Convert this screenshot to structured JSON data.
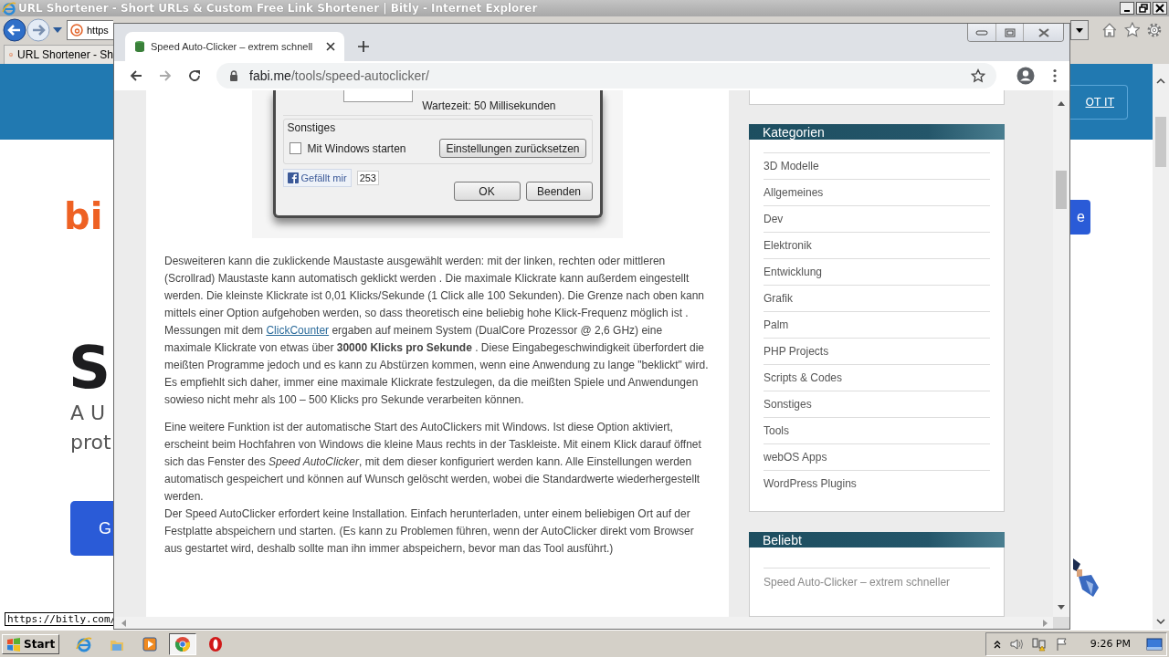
{
  "ie": {
    "title": "URL Shortener - Short URLs & Custom Free Link Shortener | Bitly - Internet Explorer",
    "address": "https",
    "tab": "URL Shortener - Sh",
    "page": {
      "banner_button": "OT IT",
      "logo": "bi",
      "heading": "S",
      "subtitle": [
        "A U",
        "prot"
      ],
      "cta": "G",
      "side_button": "e"
    },
    "status_tip": "https://bitly.com/"
  },
  "chrome": {
    "tab": {
      "title": "Speed Auto-Clicker – extrem schnell",
      "selected": true
    },
    "url": {
      "host": "fabi.me",
      "path": "/tools/speed-autoclicker/"
    },
    "screenshot": {
      "wait_text": "Wartezeit: 50 Millisekunden",
      "group": "Sonstiges",
      "checkbox": {
        "label": "Mit Windows starten",
        "checked": false
      },
      "reset_button": "Einstellungen zurücksetzen",
      "like": "Gefällt mir",
      "like_count": "253",
      "buttons": [
        "OK",
        "Beenden"
      ]
    },
    "article": [
      [
        {
          "segments": [
            {
              "kind": "text",
              "text": "Desweiteren kann die zuklickende Maustaste ausgewählt werden: mit der linken, rechten oder mittleren (Scrollrad) Maustaste kann automatisch geklickt werden . Die maximale Klickrate kann außerdem eingestellt werden. Die kleinste Klickrate ist 0,01 Klicks/Sekunde (1 Click alle 100 Sekunden). Die Grenze nach oben kann mittels einer Option aufgehoben werden, so dass theoretisch eine beliebig hohe Klick-Frequenz möglich ist ."
            }
          ]
        },
        {
          "segments": [
            {
              "kind": "text",
              "text": "Messungen mit dem "
            },
            {
              "kind": "link",
              "text": "ClickCounter"
            },
            {
              "kind": "text",
              "text": " ergaben auf meinem System (DualCore Prozessor @ 2,6 GHz) eine maximale Klickrate von etwas über **30000 Klicks pro Sekunde** . Diese Eingabegeschwindigkeit überfordert die meißten Programme jedoch und es kann zu Abstürzen kommen, wenn eine Anwendung zu lange \"beklickt\" wird. Es empfiehlt sich daher, immer eine maximale Klickrate festzulegen, da die meißten Spiele und Anwendungen sowieso nicht mehr als 100 – 500 Klicks pro Sekunde verarbeiten können."
            }
          ]
        }
      ],
      [
        {
          "segments": [
            {
              "kind": "text",
              "text": "Eine weitere Funktion ist der automatische Start des AutoClickers mit Windows. Ist diese Option aktiviert, erscheint beim Hochfahren von Windows die kleine Maus rechts in der Taskleiste. Mit einem Klick darauf öffnet sich das Fenster des *Speed AutoClicker*,  mit dem dieser konfiguriert werden kann. Alle Einstellungen werden automatisch gespeichert und können auf Wunsch gelöscht werden, wobei die Standardwerte wiederhergestellt werden."
            }
          ]
        },
        {
          "segments": [
            {
              "kind": "text",
              "text": "Der Speed AutoClicker erfordert keine Installation. Einfach herunterladen, unter einem beliebigen Ort auf der Festplatte abspeichern und starten. (Es kann zu Problemen führen, wenn der AutoClicker direkt vom Browser aus gestartet wird, deshalb sollte man ihn immer abspeichern, bevor man das Tool ausführt.)"
            }
          ]
        }
      ]
    ],
    "sidebar": {
      "categories": {
        "title": "Kategorien",
        "items": [
          "3D Modelle",
          "Allgemeines",
          "Dev",
          "Elektronik",
          "Entwicklung",
          "Grafik",
          "Palm",
          "PHP Projects",
          "Scripts & Codes",
          "Sonstiges",
          "Tools",
          "webOS Apps",
          "WordPress Plugins"
        ]
      },
      "popular": {
        "title": "Beliebt",
        "items": [
          "Speed Auto-Clicker – extrem schneller"
        ]
      }
    }
  },
  "taskbar": {
    "start": "Start",
    "apps": [
      {
        "kind": "ie",
        "selected": false
      },
      {
        "kind": "folder",
        "selected": false
      },
      {
        "kind": "media",
        "selected": false
      },
      {
        "kind": "chrome",
        "selected": true
      },
      {
        "kind": "opera",
        "selected": false
      }
    ],
    "clock": "9:26 PM"
  }
}
